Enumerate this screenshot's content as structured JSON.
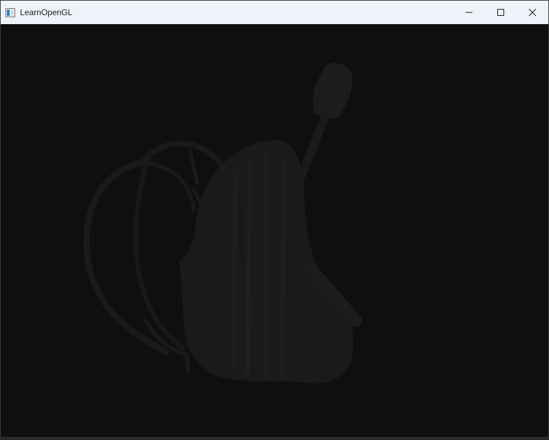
{
  "window": {
    "title": "LearnOpenGL",
    "app_icon": "window-app-icon",
    "controls": {
      "minimize": "minimize-icon",
      "maximize": "maximize-icon",
      "close": "close-icon"
    }
  },
  "scene": {
    "background_color": "#0f0f0f",
    "model_color": "#1a1a1a",
    "model_highlight": "#202020",
    "model": "backpack-silhouette"
  }
}
